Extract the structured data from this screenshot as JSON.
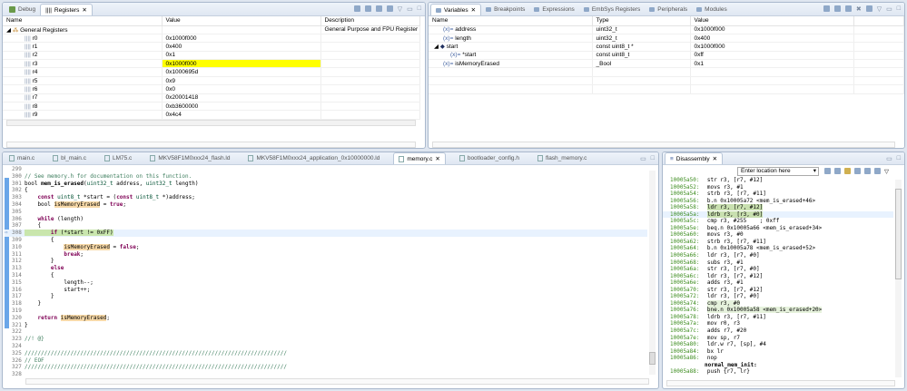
{
  "registers_pane": {
    "tabs": [
      {
        "label": "Debug"
      },
      {
        "label": "Registers"
      }
    ],
    "columns": [
      "Name",
      "Value",
      "Description"
    ],
    "group": {
      "name": "General Registers",
      "description": "General Purpose and FPU Register Group"
    },
    "rows": [
      {
        "name": "r0",
        "value": "0x1000f000"
      },
      {
        "name": "r1",
        "value": "0x400"
      },
      {
        "name": "r2",
        "value": "0x1"
      },
      {
        "name": "r3",
        "value": "0x1000f000",
        "highlight": true
      },
      {
        "name": "r4",
        "value": "0x1000695d"
      },
      {
        "name": "r5",
        "value": "0x9"
      },
      {
        "name": "r6",
        "value": "0x0"
      },
      {
        "name": "r7",
        "value": "0x20001418"
      },
      {
        "name": "r8",
        "value": "0xb3600000"
      },
      {
        "name": "r9",
        "value": "0x4c4"
      }
    ],
    "highlight_color": "#ffff00"
  },
  "variables_pane": {
    "tabs": [
      {
        "label": "Variables"
      },
      {
        "label": "Breakpoints"
      },
      {
        "label": "Expressions"
      },
      {
        "label": "EmbSys Registers"
      },
      {
        "label": "Peripherals"
      },
      {
        "label": "Modules"
      }
    ],
    "columns": [
      "Name",
      "Type",
      "Value"
    ],
    "rows": [
      {
        "name": "address",
        "type": "uint32_t",
        "value": "0x1000f000"
      },
      {
        "name": "length",
        "type": "uint32_t",
        "value": "0x400"
      },
      {
        "name": "start",
        "type": "const uint8_t *",
        "value": "0x1000f000"
      },
      {
        "name": "*start",
        "type": "const uint8_t",
        "value": "0xff"
      },
      {
        "name": "isMemoryErased",
        "type": "_Bool",
        "value": "0x1"
      }
    ]
  },
  "editor": {
    "tabs": [
      {
        "label": "main.c"
      },
      {
        "label": "bl_main.c"
      },
      {
        "label": "LM75.c"
      },
      {
        "label": "MKV58F1M0xxx24_flash.ld"
      },
      {
        "label": "MKV58F1M0xxx24_application_0x10000000.ld"
      },
      {
        "label": "memory.c",
        "active": true
      },
      {
        "label": "bootloader_config.h"
      },
      {
        "label": "flash_memory.c"
      }
    ],
    "lines": [
      {
        "n": "299",
        "t": ""
      },
      {
        "n": "300",
        "t": "// See memory.h for documentation on this function.",
        "c": "cm"
      },
      {
        "n": "301",
        "t": "bool mem_is_erased(uint32_t address, uint32_t length)"
      },
      {
        "n": "302",
        "t": "{"
      },
      {
        "n": "303",
        "t": "    const uint8_t *start = (const uint8_t *)address;"
      },
      {
        "n": "304",
        "t": "    bool isMemoryErased = true;"
      },
      {
        "n": "305",
        "t": ""
      },
      {
        "n": "306",
        "t": "    while (length)"
      },
      {
        "n": "307",
        "t": "    {"
      },
      {
        "n": "308",
        "t": "        if (*start != 0xFF)",
        "current": true
      },
      {
        "n": "309",
        "t": "        {"
      },
      {
        "n": "310",
        "t": "            isMemoryErased = false;"
      },
      {
        "n": "311",
        "t": "            break;"
      },
      {
        "n": "312",
        "t": "        }"
      },
      {
        "n": "313",
        "t": "        else"
      },
      {
        "n": "314",
        "t": "        {"
      },
      {
        "n": "315",
        "t": "            length--;"
      },
      {
        "n": "316",
        "t": "            start++;"
      },
      {
        "n": "317",
        "t": "        }"
      },
      {
        "n": "318",
        "t": "    }"
      },
      {
        "n": "319",
        "t": ""
      },
      {
        "n": "320",
        "t": "    return isMemoryErased;"
      },
      {
        "n": "321",
        "t": "}"
      },
      {
        "n": "322",
        "t": ""
      },
      {
        "n": "323",
        "t": "//! @}",
        "c": "cm"
      },
      {
        "n": "324",
        "t": ""
      },
      {
        "n": "325",
        "t": "////////////////////////////////////////////////////////////////////////////////",
        "c": "cm"
      },
      {
        "n": "326",
        "t": "// EOF",
        "c": "cm"
      },
      {
        "n": "327",
        "t": "////////////////////////////////////////////////////////////////////////////////",
        "c": "cm"
      },
      {
        "n": "328",
        "t": ""
      }
    ]
  },
  "disassembly": {
    "tab": "Disassembly",
    "location_placeholder": "Enter location here",
    "lines": [
      {
        "a": "10005a50:",
        "i": "str r3, [r7, #12]"
      },
      {
        "a": "10005a52:",
        "i": "movs r3, #1"
      },
      {
        "a": "10005a54:",
        "i": "strb r3, [r7, #11]"
      },
      {
        "a": "10005a56:",
        "i": "b.n 0x10005a72 <mem_is_erased+46>"
      },
      {
        "a": "10005a58:",
        "i": "ldr r3, [r7, #12]",
        "hl": true
      },
      {
        "a": "10005a5a:",
        "i": "ldrb r3, [r3, #0]",
        "hl": true,
        "current": true
      },
      {
        "a": "10005a5c:",
        "i": "cmp r3, #255    ; 0xff"
      },
      {
        "a": "10005a5e:",
        "i": "beq.n 0x10005a66 <mem_is_erased+34>"
      },
      {
        "a": "10005a60:",
        "i": "movs r3, #0"
      },
      {
        "a": "10005a62:",
        "i": "strb r3, [r7, #11]"
      },
      {
        "a": "10005a64:",
        "i": "b.n 0x10005a78 <mem_is_erased+52>"
      },
      {
        "a": "10005a66:",
        "i": "ldr r3, [r7, #0]"
      },
      {
        "a": "10005a68:",
        "i": "subs r3, #1"
      },
      {
        "a": "10005a6a:",
        "i": "str r3, [r7, #0]"
      },
      {
        "a": "10005a6c:",
        "i": "ldr r3, [r7, #12]"
      },
      {
        "a": "10005a6e:",
        "i": "adds r3, #1"
      },
      {
        "a": "10005a70:",
        "i": "str r3, [r7, #12]"
      },
      {
        "a": "10005a72:",
        "i": "ldr r3, [r7, #0]"
      },
      {
        "a": "10005a74:",
        "i": "cmp r3, #0",
        "lhl": true
      },
      {
        "a": "10005a76:",
        "i": "bne.n 0x10005a58 <mem_is_erased+20>",
        "lhl": true
      },
      {
        "a": "10005a78:",
        "i": "ldrb r3, [r7, #11]"
      },
      {
        "a": "10005a7a:",
        "i": "mov r0, r3"
      },
      {
        "a": "10005a7c:",
        "i": "adds r7, #20"
      },
      {
        "a": "10005a7e:",
        "i": "mov sp, r7"
      },
      {
        "a": "10005a80:",
        "i": "ldr.w r7, [sp], #4"
      },
      {
        "a": "10005a84:",
        "i": "bx lr"
      },
      {
        "a": "10005a86:",
        "i": "nop"
      },
      {
        "a": "",
        "i": "normal_mem_init:",
        "label": true
      },
      {
        "a": "10005a88:",
        "i": "push {r7, lr}"
      }
    ]
  }
}
